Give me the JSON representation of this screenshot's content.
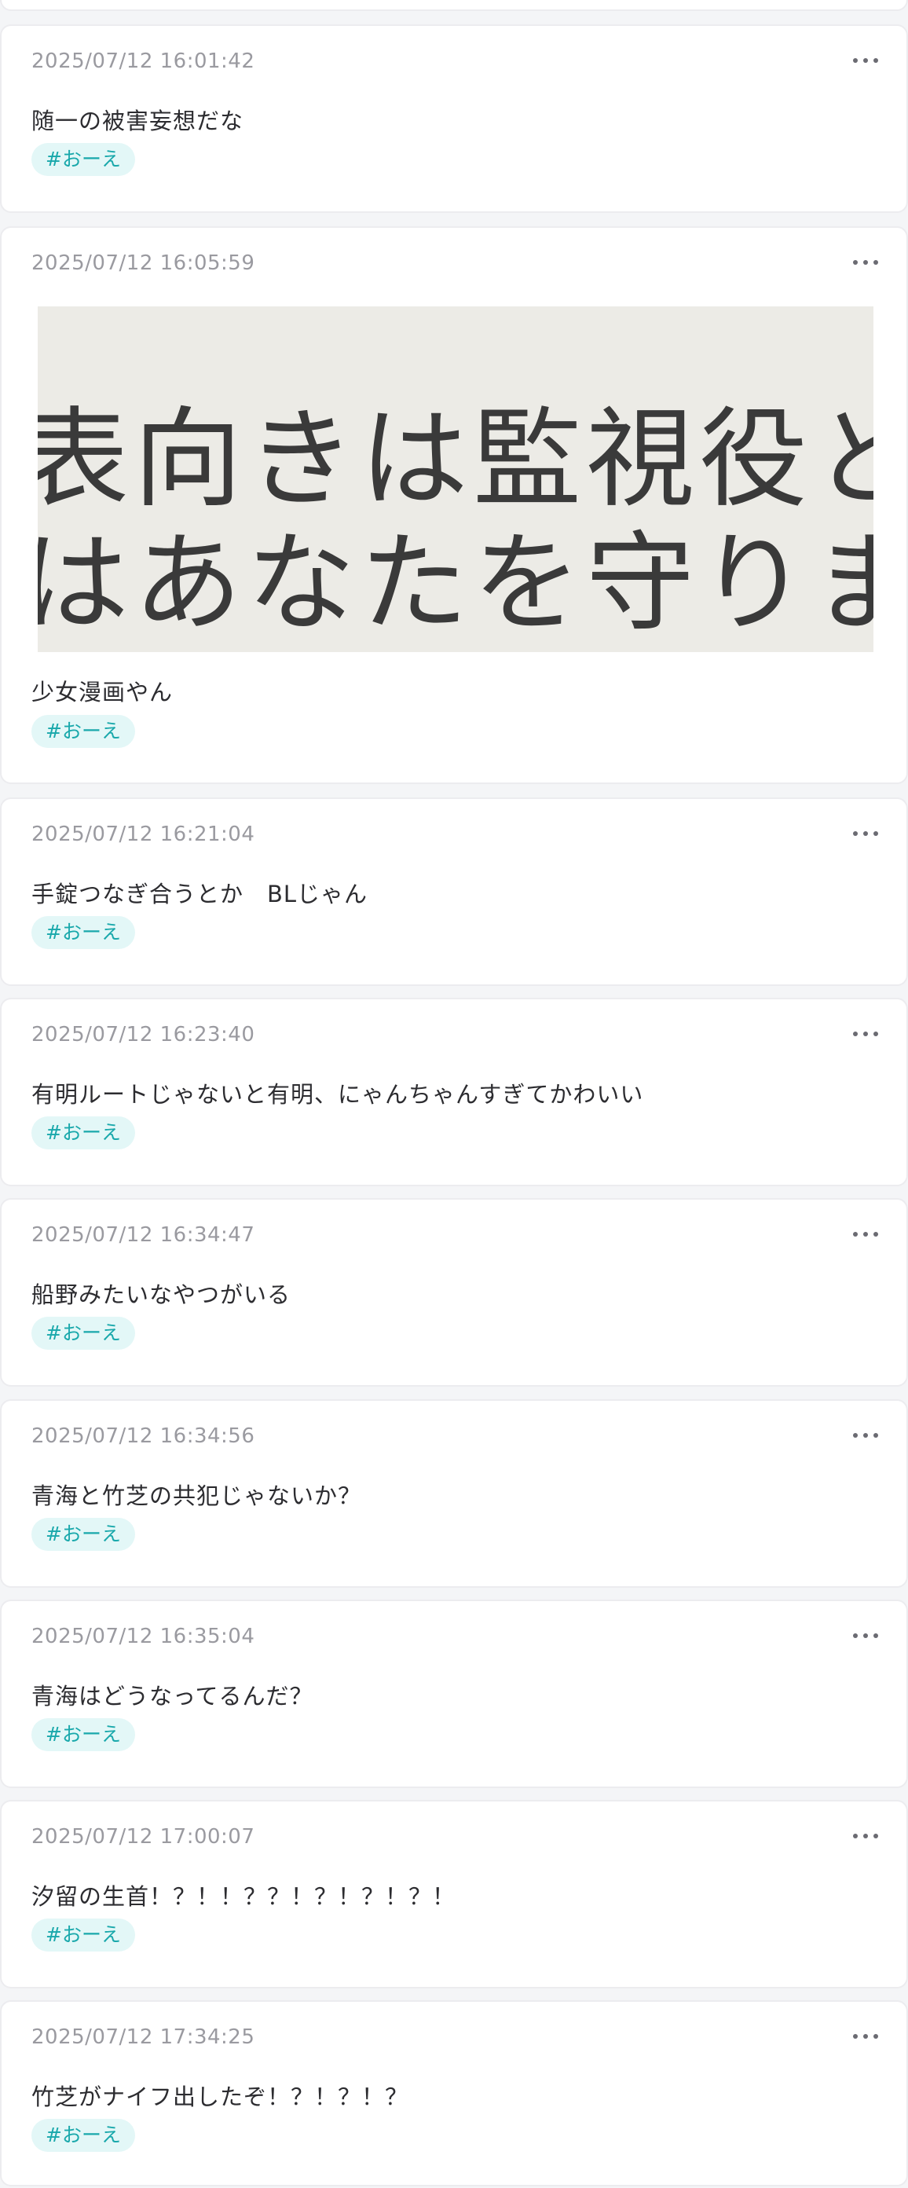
{
  "posts": [
    {
      "timestamp": "2025/07/12 16:01:42",
      "text": "随一の被害妄想だな",
      "tag": "#おーえ"
    },
    {
      "timestamp": "2025/07/12 16:05:59",
      "image": {
        "line1": "表向きは監視役と",
        "line2": "はあなたを守りま"
      },
      "text": "少女漫画やん",
      "tag": "#おーえ"
    },
    {
      "timestamp": "2025/07/12 16:21:04",
      "text": "手錠つなぎ合うとか　BLじゃん",
      "tag": "#おーえ"
    },
    {
      "timestamp": "2025/07/12 16:23:40",
      "text": "有明ルートじゃないと有明、にゃんちゃんすぎてかわいい",
      "tag": "#おーえ"
    },
    {
      "timestamp": "2025/07/12 16:34:47",
      "text": "船野みたいなやつがいる",
      "tag": "#おーえ"
    },
    {
      "timestamp": "2025/07/12 16:34:56",
      "text": "青海と竹芝の共犯じゃないか？",
      "tag": "#おーえ"
    },
    {
      "timestamp": "2025/07/12 16:35:04",
      "text": "青海はどうなってるんだ？",
      "tag": "#おーえ"
    },
    {
      "timestamp": "2025/07/12 17:00:07",
      "text": "汐留の生首！？！！？？！？！？！？！",
      "tag": "#おーえ"
    },
    {
      "timestamp": "2025/07/12 17:34:25",
      "text": "竹芝がナイフ出したぞ！？！？！？",
      "tag": "#おーえ"
    }
  ],
  "icons": {
    "more": "ellipsis-icon"
  },
  "colors": {
    "tag_bg": "#e3f7f7",
    "tag_text": "#19a8ab",
    "timestamp": "#9a9aa0"
  }
}
